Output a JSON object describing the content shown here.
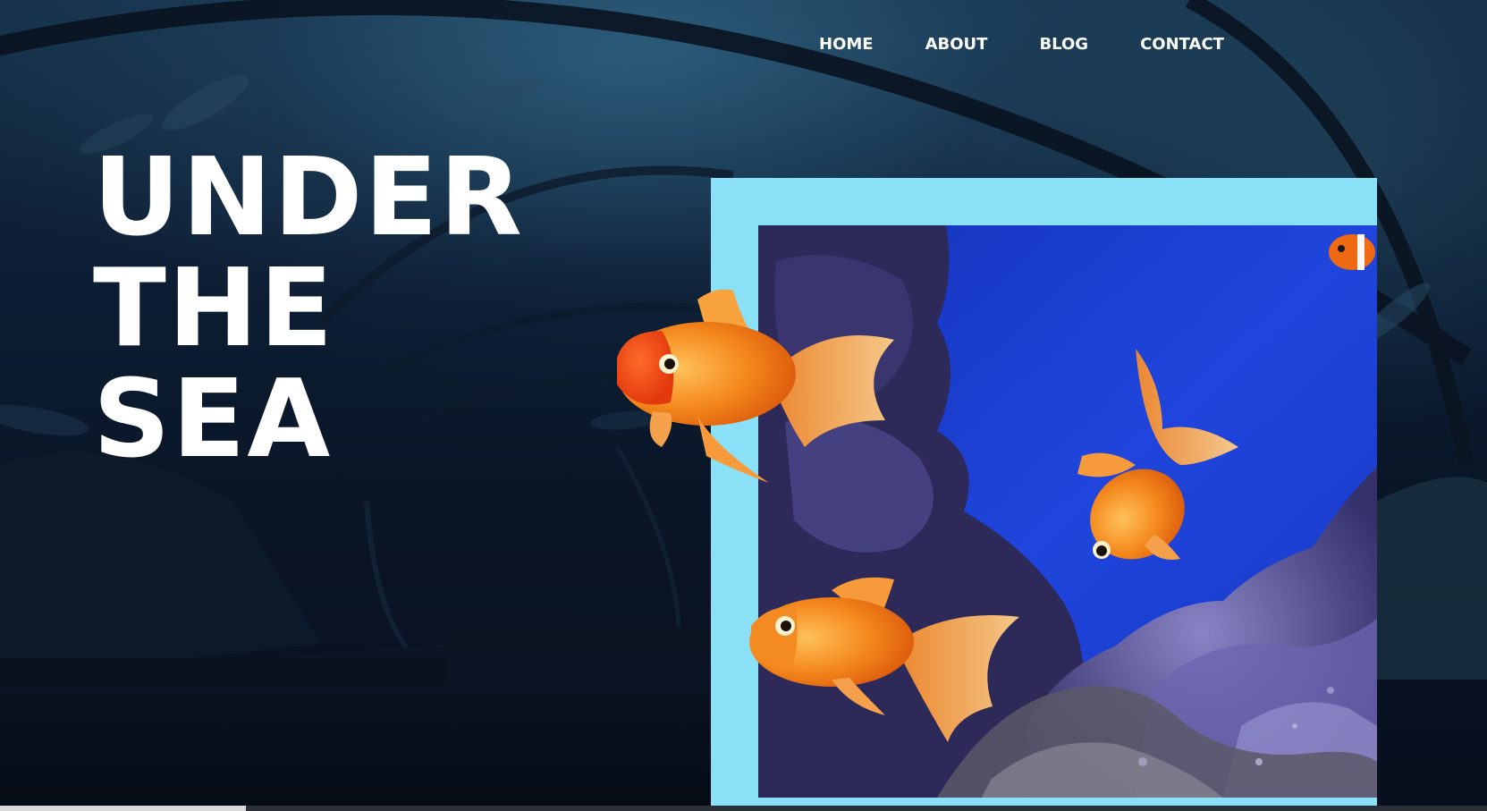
{
  "nav": {
    "items": [
      {
        "label": "HOME"
      },
      {
        "label": "ABOUT"
      },
      {
        "label": "BLOG"
      },
      {
        "label": "CONTACT"
      }
    ]
  },
  "hero": {
    "title_lines": [
      "UNDER",
      "THE",
      "SEA"
    ]
  },
  "colors": {
    "frame": "#8ae0f7",
    "text": "#ffffff",
    "background": "#0a1628",
    "photo_water": "#1e3fd6",
    "goldfish": "#f08a1c"
  }
}
